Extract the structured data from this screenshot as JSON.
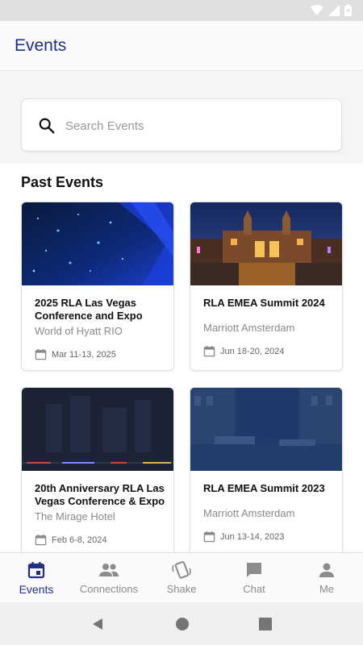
{
  "app": {
    "title": "Events"
  },
  "search": {
    "placeholder": "Search Events",
    "value": ""
  },
  "section": {
    "title": "Past Events"
  },
  "events": [
    {
      "title": "2025 RLA Las Vegas Conference and Expo",
      "venue": "World of Hyatt RIO",
      "date": "Mar 11-13, 2025"
    },
    {
      "title": "RLA EMEA Summit 2024",
      "venue": "Marriott Amsterdam",
      "date": "Jun 18-20, 2024"
    },
    {
      "title": "20th Anniversary RLA Las Vegas Conference & Expo",
      "venue": "The Mirage Hotel",
      "date": "Feb 6-8, 2024"
    },
    {
      "title": "RLA EMEA Summit 2023",
      "venue": "Marriott Amsterdam",
      "date": "Jun 13-14, 2023"
    }
  ],
  "nav": {
    "items": [
      {
        "label": "Events",
        "icon": "calendar-icon",
        "active": true
      },
      {
        "label": "Connections",
        "icon": "people-icon"
      },
      {
        "label": "Shake",
        "icon": "shake-icon"
      },
      {
        "label": "Chat",
        "icon": "chat-icon"
      },
      {
        "label": "Me",
        "icon": "person-icon"
      }
    ]
  },
  "colors": {
    "accent": "#1f2f86",
    "inactive": "#8c8c8c"
  }
}
